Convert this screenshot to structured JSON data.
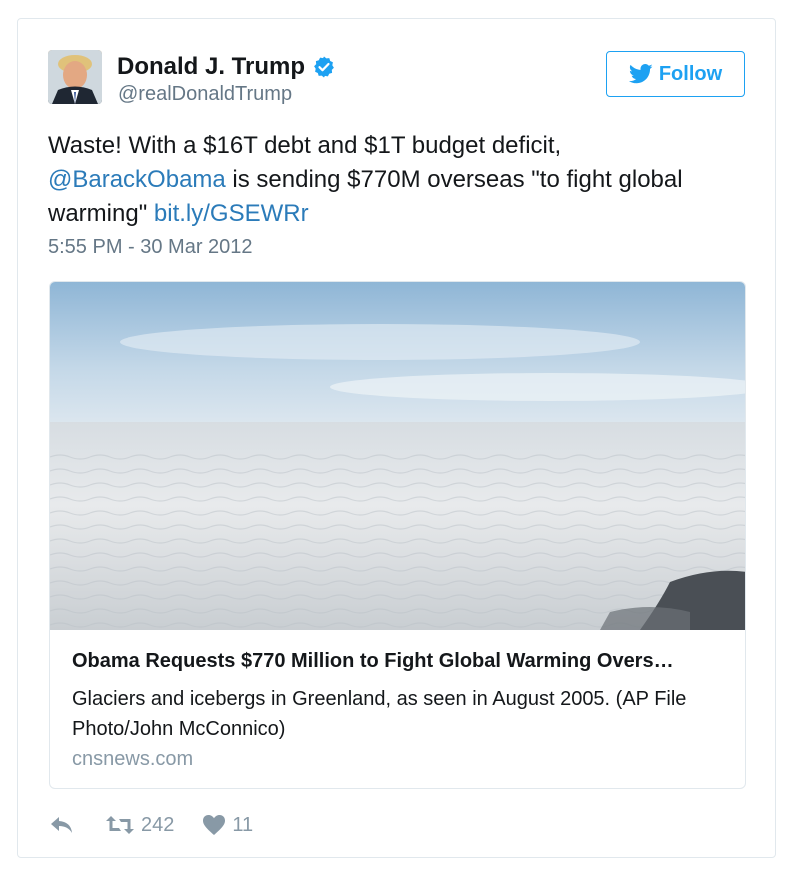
{
  "author": {
    "name": "Donald J. Trump",
    "handle": "@realDonaldTrump",
    "verified": true
  },
  "follow_label": "Follow",
  "tweet": {
    "text_part1": "Waste! With a $16T debt and $1T budget deficit, ",
    "mention": "@BarackObama",
    "text_part2": " is sending $770M overseas \"to fight global warming\" ",
    "link": "bit.ly/GSEWRr",
    "timestamp": "5:55 PM - 30 Mar 2012"
  },
  "card": {
    "title": "Obama Requests $770 Million to Fight Global Warming Overs…",
    "description": "Glaciers and icebergs in Greenland, as seen in August 2005. (AP File Photo/John McConnico)",
    "domain": "cnsnews.com"
  },
  "actions": {
    "retweets": "242",
    "likes": "11"
  },
  "colors": {
    "link": "#2b7bb9",
    "accent": "#1da1f2",
    "muted": "#657786"
  }
}
